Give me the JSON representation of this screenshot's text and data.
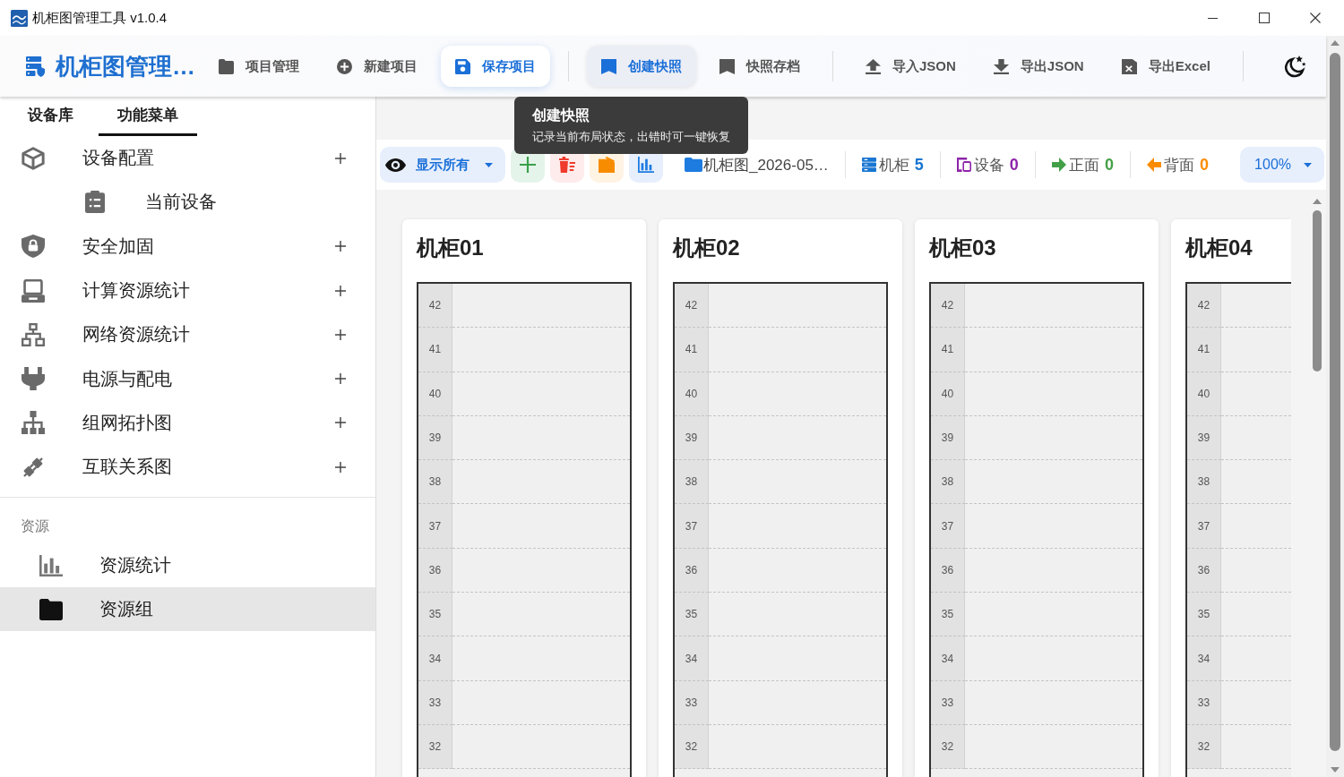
{
  "window": {
    "title": "机柜图管理工具 v1.0.4"
  },
  "header": {
    "app_name": "机柜图管理…",
    "groups": [
      [
        {
          "label": "项目管理",
          "kind": "plain"
        },
        {
          "label": "新建项目",
          "kind": "plain"
        },
        {
          "label": "保存项目",
          "kind": "raised"
        }
      ],
      [
        {
          "label": "创建快照",
          "kind": "hovered"
        },
        {
          "label": "快照存档",
          "kind": "plain"
        }
      ],
      [
        {
          "label": "导入JSON",
          "kind": "plain"
        },
        {
          "label": "导出JSON",
          "kind": "plain"
        },
        {
          "label": "导出Excel",
          "kind": "plain"
        }
      ]
    ]
  },
  "tooltip": {
    "title": "创建快照",
    "text": "记录当前布局状态，出错时可一键恢复"
  },
  "sidebar": {
    "tabs": [
      {
        "label": "设备库",
        "selected": false
      },
      {
        "label": "功能菜单",
        "selected": true
      }
    ],
    "menu": [
      {
        "label": "设备配置",
        "children": [
          {
            "label": "当前设备"
          }
        ]
      },
      {
        "label": "安全加固"
      },
      {
        "label": "计算资源统计"
      },
      {
        "label": "网络资源统计"
      },
      {
        "label": "电源与配电"
      },
      {
        "label": "组网拓扑图"
      },
      {
        "label": "互联关系图"
      }
    ],
    "section": {
      "heading": "资源",
      "items": [
        {
          "label": "资源统计",
          "selected": false
        },
        {
          "label": "资源组",
          "selected": true
        }
      ]
    }
  },
  "toolbar": {
    "filter": "显示所有",
    "file_name": "机柜图_2026-05…",
    "stats": [
      {
        "label": "机柜",
        "value": "5",
        "color": "#1976d2"
      },
      {
        "label": "设备",
        "value": "0",
        "color": "#8e24aa"
      },
      {
        "label": "正面",
        "value": "0",
        "color": "#43a047"
      },
      {
        "label": "背面",
        "value": "0",
        "color": "#fb8c00"
      }
    ],
    "zoom": "100%"
  },
  "racks": [
    {
      "name": "机柜01",
      "units": [
        "42",
        "41",
        "40",
        "39",
        "38",
        "37",
        "36",
        "35",
        "34",
        "33",
        "32"
      ]
    },
    {
      "name": "机柜02",
      "units": [
        "42",
        "41",
        "40",
        "39",
        "38",
        "37",
        "36",
        "35",
        "34",
        "33",
        "32"
      ]
    },
    {
      "name": "机柜03",
      "units": [
        "42",
        "41",
        "40",
        "39",
        "38",
        "37",
        "36",
        "35",
        "34",
        "33",
        "32"
      ]
    },
    {
      "name": "机柜04",
      "units": [
        "42",
        "41",
        "40",
        "39",
        "38",
        "37",
        "36",
        "35",
        "34",
        "33",
        "32"
      ]
    }
  ]
}
